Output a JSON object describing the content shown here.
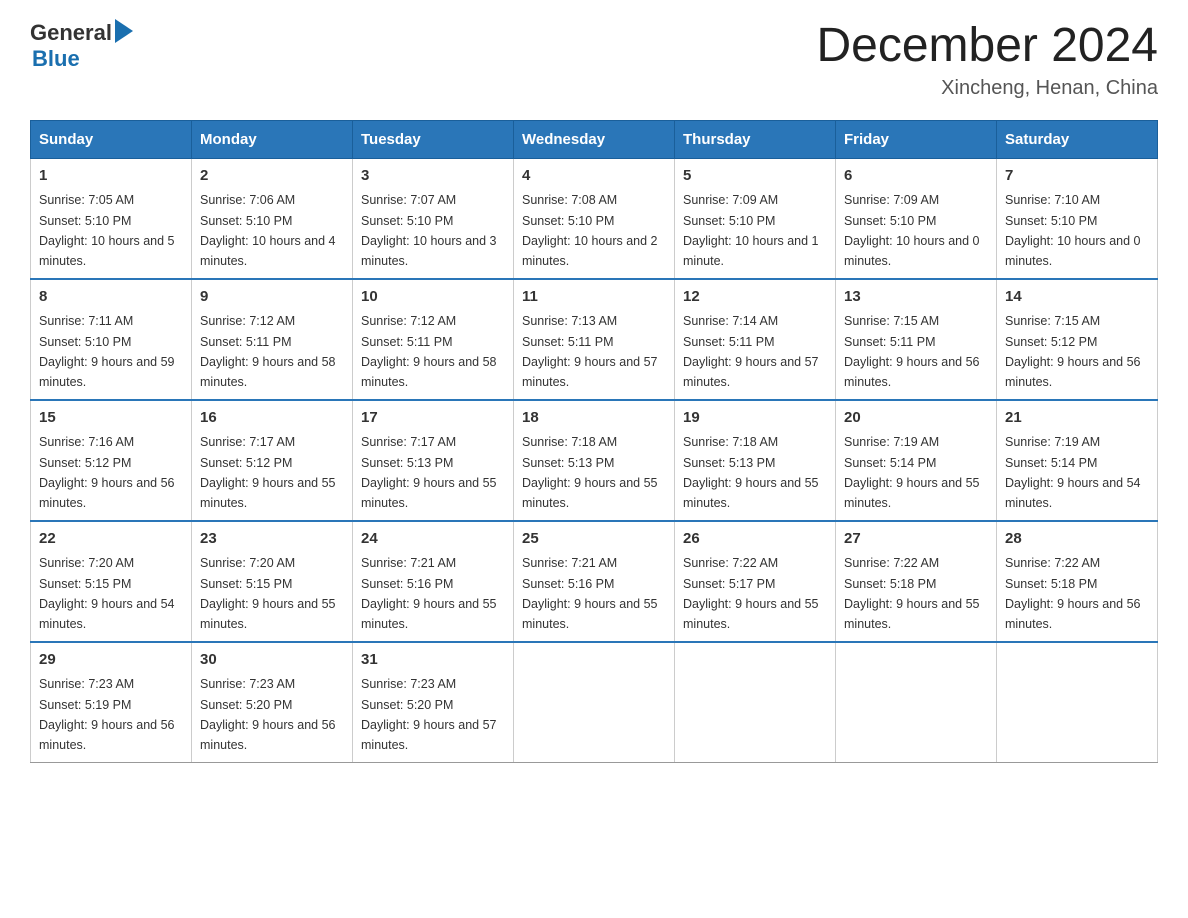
{
  "header": {
    "logo_general": "General",
    "logo_blue": "Blue",
    "main_title": "December 2024",
    "subtitle": "Xincheng, Henan, China"
  },
  "calendar": {
    "headers": [
      "Sunday",
      "Monday",
      "Tuesday",
      "Wednesday",
      "Thursday",
      "Friday",
      "Saturday"
    ],
    "weeks": [
      [
        {
          "day": "1",
          "sunrise": "7:05 AM",
          "sunset": "5:10 PM",
          "daylight": "10 hours and 5 minutes."
        },
        {
          "day": "2",
          "sunrise": "7:06 AM",
          "sunset": "5:10 PM",
          "daylight": "10 hours and 4 minutes."
        },
        {
          "day": "3",
          "sunrise": "7:07 AM",
          "sunset": "5:10 PM",
          "daylight": "10 hours and 3 minutes."
        },
        {
          "day": "4",
          "sunrise": "7:08 AM",
          "sunset": "5:10 PM",
          "daylight": "10 hours and 2 minutes."
        },
        {
          "day": "5",
          "sunrise": "7:09 AM",
          "sunset": "5:10 PM",
          "daylight": "10 hours and 1 minute."
        },
        {
          "day": "6",
          "sunrise": "7:09 AM",
          "sunset": "5:10 PM",
          "daylight": "10 hours and 0 minutes."
        },
        {
          "day": "7",
          "sunrise": "7:10 AM",
          "sunset": "5:10 PM",
          "daylight": "10 hours and 0 minutes."
        }
      ],
      [
        {
          "day": "8",
          "sunrise": "7:11 AM",
          "sunset": "5:10 PM",
          "daylight": "9 hours and 59 minutes."
        },
        {
          "day": "9",
          "sunrise": "7:12 AM",
          "sunset": "5:11 PM",
          "daylight": "9 hours and 58 minutes."
        },
        {
          "day": "10",
          "sunrise": "7:12 AM",
          "sunset": "5:11 PM",
          "daylight": "9 hours and 58 minutes."
        },
        {
          "day": "11",
          "sunrise": "7:13 AM",
          "sunset": "5:11 PM",
          "daylight": "9 hours and 57 minutes."
        },
        {
          "day": "12",
          "sunrise": "7:14 AM",
          "sunset": "5:11 PM",
          "daylight": "9 hours and 57 minutes."
        },
        {
          "day": "13",
          "sunrise": "7:15 AM",
          "sunset": "5:11 PM",
          "daylight": "9 hours and 56 minutes."
        },
        {
          "day": "14",
          "sunrise": "7:15 AM",
          "sunset": "5:12 PM",
          "daylight": "9 hours and 56 minutes."
        }
      ],
      [
        {
          "day": "15",
          "sunrise": "7:16 AM",
          "sunset": "5:12 PM",
          "daylight": "9 hours and 56 minutes."
        },
        {
          "day": "16",
          "sunrise": "7:17 AM",
          "sunset": "5:12 PM",
          "daylight": "9 hours and 55 minutes."
        },
        {
          "day": "17",
          "sunrise": "7:17 AM",
          "sunset": "5:13 PM",
          "daylight": "9 hours and 55 minutes."
        },
        {
          "day": "18",
          "sunrise": "7:18 AM",
          "sunset": "5:13 PM",
          "daylight": "9 hours and 55 minutes."
        },
        {
          "day": "19",
          "sunrise": "7:18 AM",
          "sunset": "5:13 PM",
          "daylight": "9 hours and 55 minutes."
        },
        {
          "day": "20",
          "sunrise": "7:19 AM",
          "sunset": "5:14 PM",
          "daylight": "9 hours and 55 minutes."
        },
        {
          "day": "21",
          "sunrise": "7:19 AM",
          "sunset": "5:14 PM",
          "daylight": "9 hours and 54 minutes."
        }
      ],
      [
        {
          "day": "22",
          "sunrise": "7:20 AM",
          "sunset": "5:15 PM",
          "daylight": "9 hours and 54 minutes."
        },
        {
          "day": "23",
          "sunrise": "7:20 AM",
          "sunset": "5:15 PM",
          "daylight": "9 hours and 55 minutes."
        },
        {
          "day": "24",
          "sunrise": "7:21 AM",
          "sunset": "5:16 PM",
          "daylight": "9 hours and 55 minutes."
        },
        {
          "day": "25",
          "sunrise": "7:21 AM",
          "sunset": "5:16 PM",
          "daylight": "9 hours and 55 minutes."
        },
        {
          "day": "26",
          "sunrise": "7:22 AM",
          "sunset": "5:17 PM",
          "daylight": "9 hours and 55 minutes."
        },
        {
          "day": "27",
          "sunrise": "7:22 AM",
          "sunset": "5:18 PM",
          "daylight": "9 hours and 55 minutes."
        },
        {
          "day": "28",
          "sunrise": "7:22 AM",
          "sunset": "5:18 PM",
          "daylight": "9 hours and 56 minutes."
        }
      ],
      [
        {
          "day": "29",
          "sunrise": "7:23 AM",
          "sunset": "5:19 PM",
          "daylight": "9 hours and 56 minutes."
        },
        {
          "day": "30",
          "sunrise": "7:23 AM",
          "sunset": "5:20 PM",
          "daylight": "9 hours and 56 minutes."
        },
        {
          "day": "31",
          "sunrise": "7:23 AM",
          "sunset": "5:20 PM",
          "daylight": "9 hours and 57 minutes."
        },
        null,
        null,
        null,
        null
      ]
    ]
  }
}
